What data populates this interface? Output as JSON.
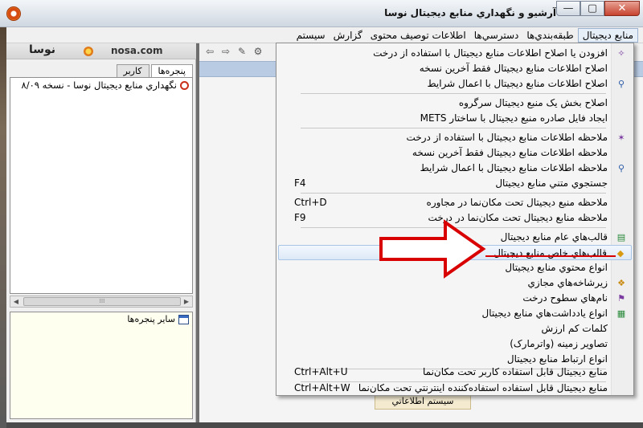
{
  "window": {
    "title": "آرشیو و نگهداري منابع ديجيتال نوسا",
    "min": "—",
    "max": "▢",
    "close": "✕"
  },
  "menubar": {
    "items": [
      {
        "label": "منابع ديجيتال",
        "active": true
      },
      {
        "label": "طبقه‌بندي‌ها"
      },
      {
        "label": "دسترسي‌ها"
      },
      {
        "label": "اطلاعات توصيف محتوی"
      },
      {
        "label": "گزارش"
      },
      {
        "label": "سيستم"
      }
    ]
  },
  "leftpanel": {
    "logo_url": "nosa.com",
    "logo_fa": "نوسا",
    "tabs": [
      {
        "label": "پنجره‌ها",
        "selected": true
      },
      {
        "label": "کاربر"
      }
    ],
    "tree_item": "نگهداري منابع ديجيتال نوسا - نسخه ۸/۰۹",
    "other_windows": "ساير پنجره‌ها"
  },
  "rightarea": {
    "footer": "سيستم اطلاعاتي"
  },
  "dropdown": {
    "items": [
      {
        "label": "افزودن يا اصلاح اطلاعات منابع ديجيتال با استفاده از درخت",
        "icon": "add-wand-icon",
        "shortcut": ""
      },
      {
        "label": "اصلاح اطلاعات منابع ديجيتال فقط آخرين نسخه",
        "icon": "",
        "shortcut": ""
      },
      {
        "label": "اصلاح اطلاعات منابع ديجيتال با اعمال شرايط",
        "icon": "filter-edit-icon",
        "shortcut": ""
      },
      {
        "label": "اصلاح بخش يک منبع ديجيتال سرگروه",
        "icon": "",
        "shortcut": ""
      },
      {
        "label": "ايجاد فايل صادره منبع ديجيتال با ساختار METS",
        "icon": "",
        "shortcut": ""
      },
      {
        "label": "ملاحظه اطلاعات منابع ديجيتال با استفاده از درخت",
        "icon": "tree-view-icon",
        "shortcut": ""
      },
      {
        "label": "ملاحظه اطلاعات منابع ديجيتال فقط آخرين نسخه",
        "icon": "",
        "shortcut": ""
      },
      {
        "label": "ملاحظه اطلاعات منابع ديجيتال با اعمال شرايط",
        "icon": "filter-view-icon",
        "shortcut": ""
      },
      {
        "label": "جستجوي متني منابع ديجيتال",
        "icon": "",
        "shortcut": "F4"
      },
      {
        "label": "ملاحظه منبع ديجيتال تحت مکان‌نما در مجاوره",
        "icon": "",
        "shortcut": "Ctrl+D"
      },
      {
        "label": "ملاحظه منابع ديجيتال تحت مکان‌نما در درخت",
        "icon": "",
        "shortcut": "F9"
      },
      {
        "label": "قالب‌هاي عام منابع ديجيتال",
        "icon": "template-general-icon",
        "shortcut": ""
      },
      {
        "label": "قالب‌هاي خاص منابع ديجيتال",
        "icon": "template-special-icon",
        "shortcut": "",
        "highlighted": true
      },
      {
        "label": "انواع محتوي منابع ديجيتال",
        "icon": "",
        "shortcut": ""
      },
      {
        "label": "زيرشاخه‌هاي مجازي",
        "icon": "virtual-branch-icon",
        "shortcut": ""
      },
      {
        "label": "نام‌هاي سطوح درخت",
        "icon": "tree-levels-icon",
        "shortcut": ""
      },
      {
        "label": "انواع يادداشت‌هاي منابع ديجيتال",
        "icon": "notes-icon",
        "shortcut": ""
      },
      {
        "label": "کلمات کم ارزش",
        "icon": "",
        "shortcut": ""
      },
      {
        "label": "تصاوير زمينه (واترمارک)",
        "icon": "",
        "shortcut": ""
      },
      {
        "label": "انواع ارتباط منابع ديجيتال",
        "icon": "",
        "shortcut": ""
      },
      {
        "label": "منابع ديجيتال قابل استفاده کاربر تحت مکان‌نما",
        "icon": "",
        "shortcut": "Ctrl+Alt+U"
      },
      {
        "label": "منابع ديجيتال قابل استفاده استفاده‌کننده اينترنتي تحت مکان‌نما",
        "icon": "",
        "shortcut": "Ctrl+Alt+W"
      }
    ]
  }
}
